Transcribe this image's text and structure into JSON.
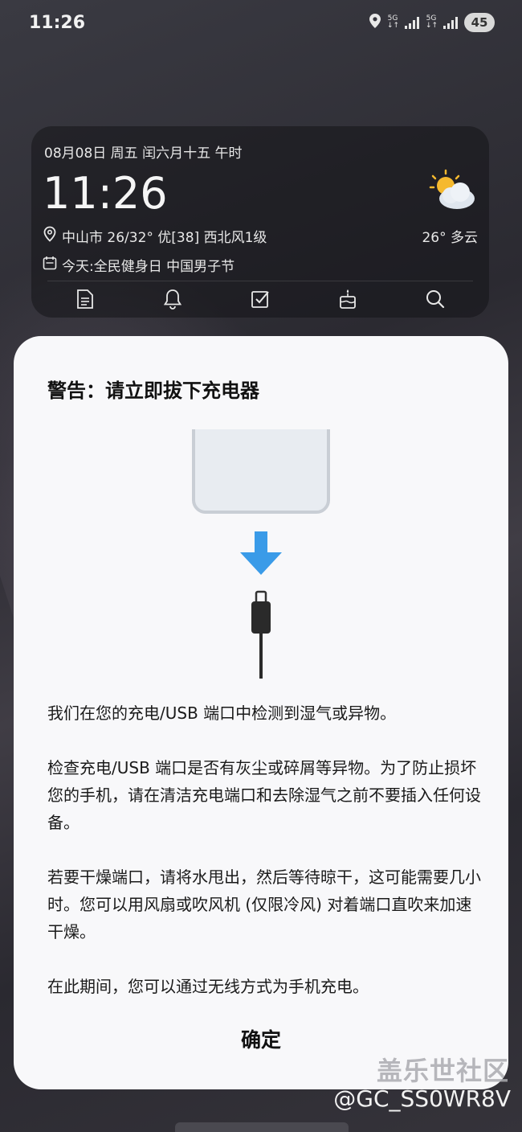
{
  "status_bar": {
    "time": "11:26",
    "network_1": "5G",
    "network_2": "5G",
    "battery": "45"
  },
  "widget": {
    "date_line": "08月08日  周五  闰六月十五  午时",
    "time": "11:26",
    "location_line": "中山市 26/32°  优[38]  西北风1级",
    "holiday_line": "今天:全民健身日  中国男子节",
    "weather": "26°  多云",
    "tools": [
      "note-icon",
      "bell-icon",
      "checkbox-icon",
      "cake-icon",
      "search-icon"
    ]
  },
  "dialog": {
    "title": "警告：请立即拔下充电器",
    "paragraphs": [
      "我们在您的充电/USB 端口中检测到湿气或异物。",
      "检查充电/USB 端口是否有灰尘或碎屑等异物。为了防止损坏您的手机，请在清洁充电端口和去除湿气之前不要插入任何设备。",
      "若要干燥端口，请将水甩出，然后等待晾干，这可能需要几小时。您可以用风扇或吹风机 (仅限冷风) 对着端口直吹来加速干燥。",
      "在此期间，您可以通过无线方式为手机充电。"
    ],
    "ok_label": "确定",
    "arrow_color": "#3a9be8"
  },
  "watermark": {
    "brand": "盖乐世社区",
    "user": "@GC_SS0WR8V"
  }
}
